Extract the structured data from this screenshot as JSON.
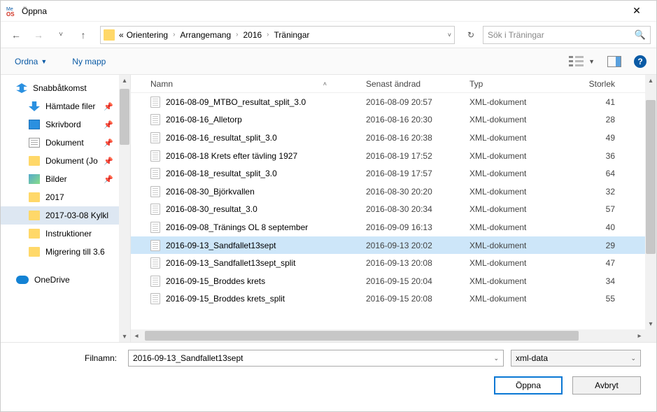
{
  "title": "Öppna",
  "icon_text_top": "Me",
  "icon_text_bot": "OS",
  "breadcrumb": {
    "root_prefix": "«",
    "items": [
      "Orientering",
      "Arrangemang",
      "2016",
      "Träningar"
    ]
  },
  "search_placeholder": "Sök i Träningar",
  "toolbar": {
    "organize": "Ordna",
    "new_folder": "Ny mapp"
  },
  "columns": {
    "name": "Namn",
    "date": "Senast ändrad",
    "type": "Typ",
    "size": "Storlek"
  },
  "sidebar": {
    "quick": "Snabbåtkomst",
    "items": [
      {
        "label": "Hämtade filer",
        "icon": "download",
        "pin": true
      },
      {
        "label": "Skrivbord",
        "icon": "desktop",
        "pin": true
      },
      {
        "label": "Dokument",
        "icon": "doc",
        "pin": true
      },
      {
        "label": "Dokument (Jo",
        "icon": "folder",
        "pin": true
      },
      {
        "label": "Bilder",
        "icon": "pics",
        "pin": true
      },
      {
        "label": "2017",
        "icon": "folder",
        "pin": false
      },
      {
        "label": "2017-03-08 Kylkl",
        "icon": "folder",
        "pin": false,
        "selected": true
      },
      {
        "label": "Instruktioner",
        "icon": "folder",
        "pin": false
      },
      {
        "label": "Migrering till 3.6",
        "icon": "folder",
        "pin": false
      }
    ],
    "onedrive": "OneDrive"
  },
  "files": [
    {
      "name": "2016-08-09_MTBO_resultat_split_3.0",
      "date": "2016-08-09 20:57",
      "type": "XML-dokument",
      "size": "41"
    },
    {
      "name": "2016-08-16_Alletorp",
      "date": "2016-08-16 20:30",
      "type": "XML-dokument",
      "size": "28"
    },
    {
      "name": "2016-08-16_resultat_split_3.0",
      "date": "2016-08-16 20:38",
      "type": "XML-dokument",
      "size": "49"
    },
    {
      "name": "2016-08-18 Krets efter tävling 1927",
      "date": "2016-08-19 17:52",
      "type": "XML-dokument",
      "size": "36"
    },
    {
      "name": "2016-08-18_resultat_split_3.0",
      "date": "2016-08-19 17:57",
      "type": "XML-dokument",
      "size": "64"
    },
    {
      "name": "2016-08-30_Björkvallen",
      "date": "2016-08-30 20:20",
      "type": "XML-dokument",
      "size": "32"
    },
    {
      "name": "2016-08-30_resultat_3.0",
      "date": "2016-08-30 20:34",
      "type": "XML-dokument",
      "size": "57"
    },
    {
      "name": "2016-09-08_Tränings OL 8 september",
      "date": "2016-09-09 16:13",
      "type": "XML-dokument",
      "size": "40"
    },
    {
      "name": "2016-09-13_Sandfallet13sept",
      "date": "2016-09-13 20:02",
      "type": "XML-dokument",
      "size": "29",
      "selected": true
    },
    {
      "name": "2016-09-13_Sandfallet13sept_split",
      "date": "2016-09-13 20:08",
      "type": "XML-dokument",
      "size": "47"
    },
    {
      "name": "2016-09-15_Broddes krets",
      "date": "2016-09-15 20:04",
      "type": "XML-dokument",
      "size": "34"
    },
    {
      "name": "2016-09-15_Broddes krets_split",
      "date": "2016-09-15 20:08",
      "type": "XML-dokument",
      "size": "55"
    }
  ],
  "bottom": {
    "filename_label": "Filnamn:",
    "filename_value": "2016-09-13_Sandfallet13sept",
    "filter_value": "xml-data",
    "open": "Öppna",
    "cancel": "Avbryt"
  }
}
